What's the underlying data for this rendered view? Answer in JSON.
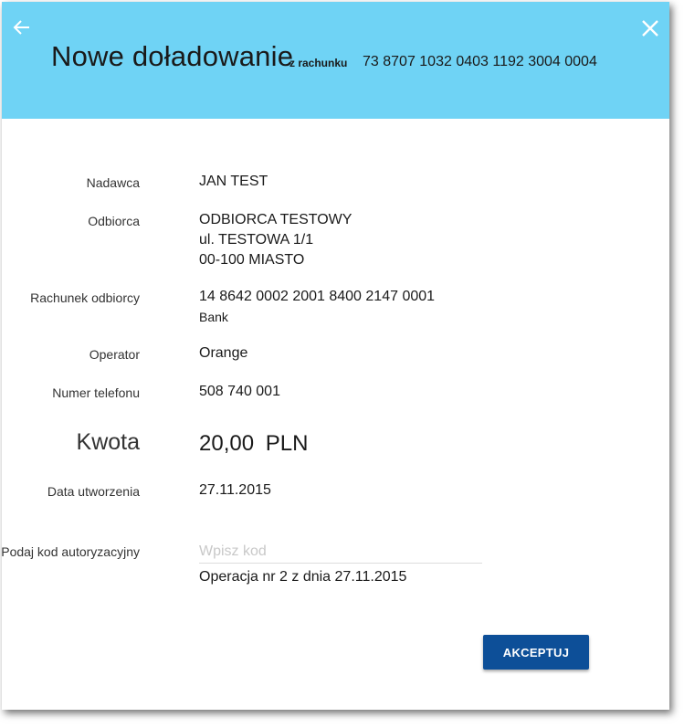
{
  "header": {
    "title": "Nowe doładowanie",
    "from_label": "z rachunku",
    "from_account": "73 8707 1032 0403 1192 3004 0004",
    "bg_color": "#6fd3f5"
  },
  "icons": {
    "back": "arrow-left-icon",
    "close": "close-icon"
  },
  "details": {
    "sender_label": "Nadawca",
    "sender_value": "JAN TEST",
    "recipient_label": "Odbiorca",
    "recipient_line1": "ODBIORCA TESTOWY",
    "recipient_line2": "ul. TESTOWA 1/1",
    "recipient_line3": "00-100 MIASTO",
    "account_label": "Rachunek odbiorcy",
    "account_value": "14 8642 0002 2001 8400 2147 0001",
    "account_bank": "Bank",
    "operator_label": "Operator",
    "operator_value": "Orange",
    "phone_label": "Numer telefonu",
    "phone_value": "508 740 001",
    "amount_label": "Kwota",
    "amount_value": "20,00",
    "amount_currency": "PLN",
    "created_label": "Data utworzenia",
    "created_value": "27.11.2015"
  },
  "auth": {
    "label": "Podaj kod autoryzacyjny",
    "placeholder": "Wpisz kod",
    "operation_info": "Operacja nr 2 z dnia 27.11.2015"
  },
  "actions": {
    "accept_label": "AKCEPTUJ",
    "accept_color": "#0d4f98"
  }
}
